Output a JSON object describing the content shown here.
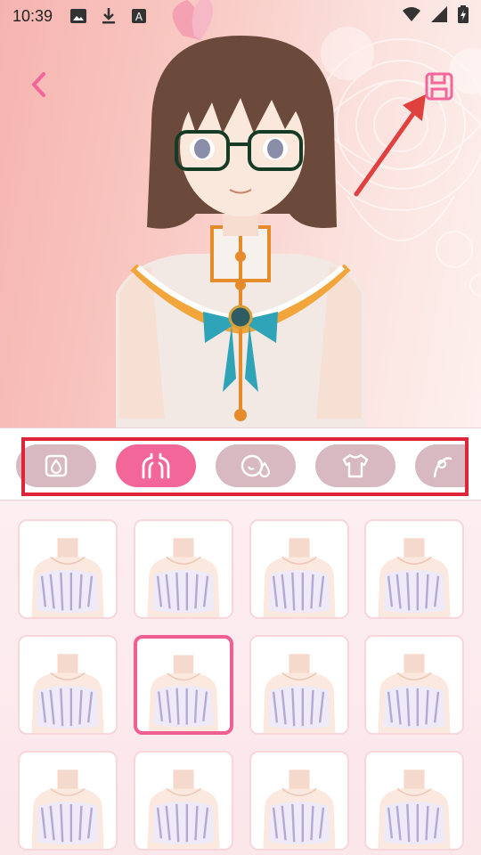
{
  "status_bar": {
    "time": "10:39",
    "left_icons": [
      "image-icon",
      "download-icon",
      "font-a-icon"
    ],
    "right_icons": [
      "wifi-icon",
      "signal-icon",
      "battery-charging-icon"
    ]
  },
  "header": {
    "back_icon": "chevron-left-icon",
    "save_icon": "floppy-save-icon"
  },
  "categories": [
    {
      "name": "skin",
      "icon": "drop-square-icon",
      "active": false
    },
    {
      "name": "body",
      "icon": "body-shape-icon",
      "active": true
    },
    {
      "name": "face",
      "icon": "face-drop-icon",
      "active": false
    },
    {
      "name": "clothes",
      "icon": "tshirt-icon",
      "active": false
    },
    {
      "name": "accessory",
      "icon": "ribbon-icon",
      "active": false
    }
  ],
  "grid": {
    "columns": 4,
    "selected_index": 5,
    "items_visible": 12
  },
  "colors": {
    "accent": "#f2669a",
    "pill": "#d8b9c1",
    "highlight_frame": "#e0243a",
    "arrow": "#e0413f",
    "background": "#fdeef0"
  }
}
